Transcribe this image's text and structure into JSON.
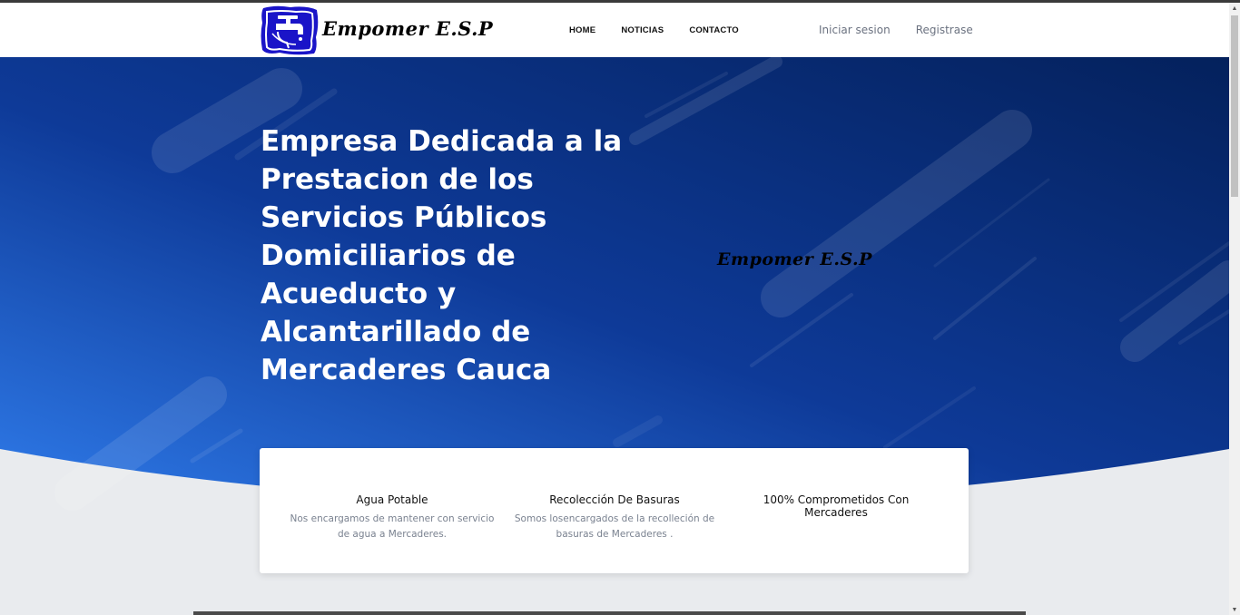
{
  "header": {
    "logo_text": "Empomer E.S.P",
    "nav": [
      {
        "label": "HOME"
      },
      {
        "label": "NOTICIAS"
      },
      {
        "label": "CONTACTO"
      }
    ],
    "auth": {
      "login": "Iniciar sesion",
      "register": "Registrase"
    }
  },
  "hero": {
    "title": "Empresa Dedicada a la Prestacion de los Servicios Públicos Domiciliarios de Acueducto y Alcantarillado de Mercaderes Cauca",
    "brand": "Empomer E.S.P",
    "colors": {
      "gradient_start": "#2f7bea",
      "gradient_end": "#05235f"
    }
  },
  "features": [
    {
      "title": "Agua Potable",
      "description": "Nos encargamos de mantener con servicio de agua a Mercaderes."
    },
    {
      "title": "Recolección De Basuras",
      "description": "Somos losencargados de la recolleción de basuras de Mercaderes ."
    },
    {
      "title": "100% Comprometidos Con Mercaderes",
      "description": ""
    }
  ],
  "scrollbar": {
    "up_icon": "▲",
    "down_icon": "▼"
  }
}
